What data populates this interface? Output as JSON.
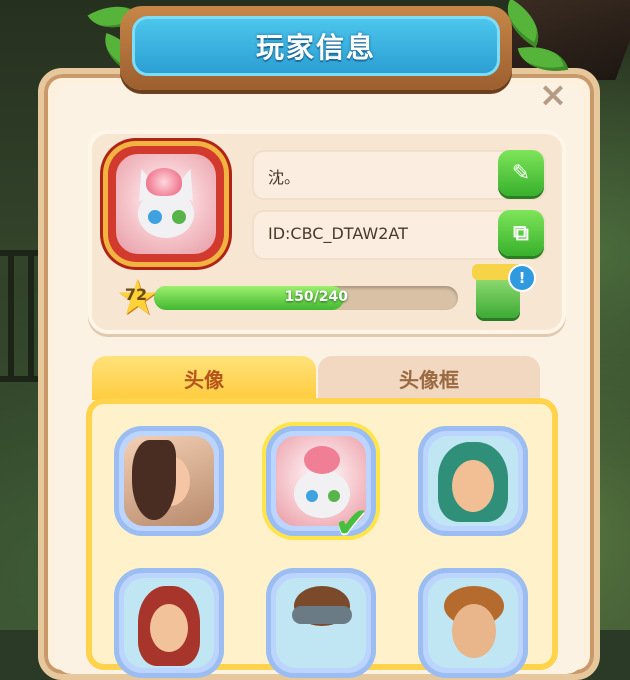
{
  "title": "玩家信息",
  "close_icon": "×",
  "profile": {
    "name": "沈。",
    "player_id": "ID:CBC_DTAW2AT",
    "level": "72",
    "xp_text": "150/240",
    "xp_fraction": 0.625,
    "edit_icon": "✎",
    "copy_icon": "⧉",
    "gift_badge": "!"
  },
  "tabs": [
    {
      "label": "头像",
      "active": true
    },
    {
      "label": "头像框",
      "active": false
    }
  ],
  "colors": {
    "title_blue": "#2b9fd3",
    "button_green": "#38b02c",
    "tab_active": "#ffcc3f",
    "xp_green": "#43b832"
  },
  "grid": {
    "check_icon": "✔"
  }
}
